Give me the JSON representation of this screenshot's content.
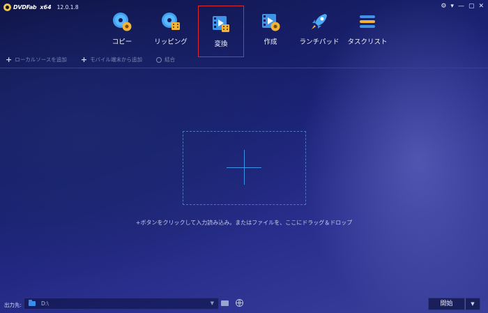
{
  "app": {
    "name": "DVDFab",
    "arch": "x64",
    "version": "12.0.1.8"
  },
  "window_controls": [
    "⚙",
    "▾",
    "—",
    "▢",
    "✕"
  ],
  "nav": {
    "items": [
      {
        "label": "コピー",
        "icon": "disc-copy-icon"
      },
      {
        "label": "リッピング",
        "icon": "disc-rip-icon"
      },
      {
        "label": "変換",
        "icon": "video-convert-icon",
        "active": true
      },
      {
        "label": "作成",
        "icon": "create-disc-icon"
      },
      {
        "label": "ランチパッド",
        "icon": "rocket-icon"
      },
      {
        "label": "タスクリスト",
        "icon": "task-list-icon"
      }
    ]
  },
  "toolbar": {
    "add_local": "ローカルソースを追加",
    "add_mobile": "モバイル端末から追加",
    "merge": "結合"
  },
  "main": {
    "hint": "+ボタンをクリックして入力読み込み。またはファイルを、ここにドラッグ＆ドロップ"
  },
  "bottom": {
    "output_label": "出力先:",
    "output_value": "D:\\",
    "start_label": "開始"
  },
  "colors": {
    "accent": "#3f93e6",
    "active_border": "#e0262e"
  }
}
